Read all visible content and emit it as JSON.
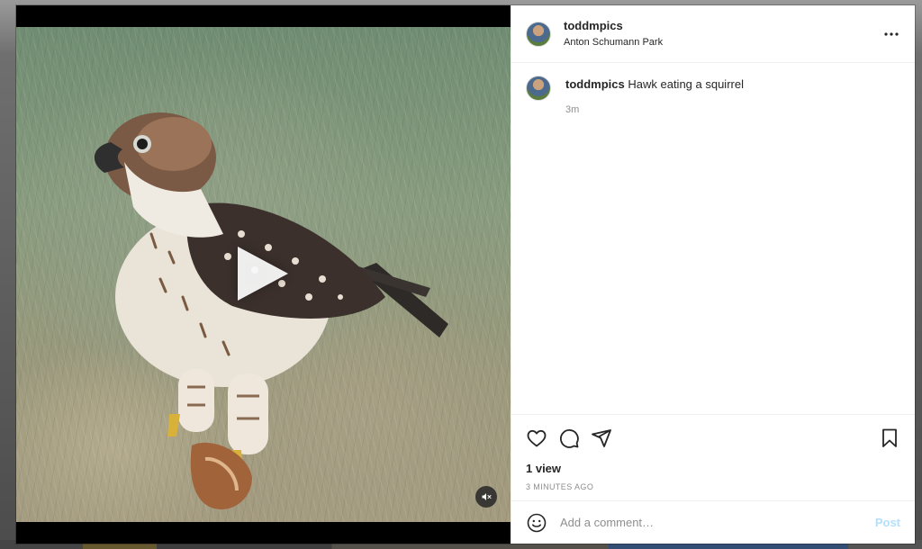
{
  "post": {
    "username": "toddmpics",
    "location": "Anton Schumann Park",
    "caption": "Hawk eating a squirrel",
    "caption_time": "3m",
    "views": "1 view",
    "time_ago": "3 MINUTES AGO"
  },
  "comment": {
    "placeholder": "Add a comment…",
    "post_label": "Post"
  },
  "icons": {
    "more": "more-options-icon",
    "like": "heart-icon",
    "comment": "comment-icon",
    "share": "share-icon",
    "save": "bookmark-icon",
    "emoji": "emoji-icon",
    "play": "play-icon",
    "mute": "muted-speaker-icon"
  },
  "colors": {
    "post_button_disabled": "#b2dffc",
    "text_primary": "#262626",
    "text_secondary": "#8e8e8e"
  }
}
